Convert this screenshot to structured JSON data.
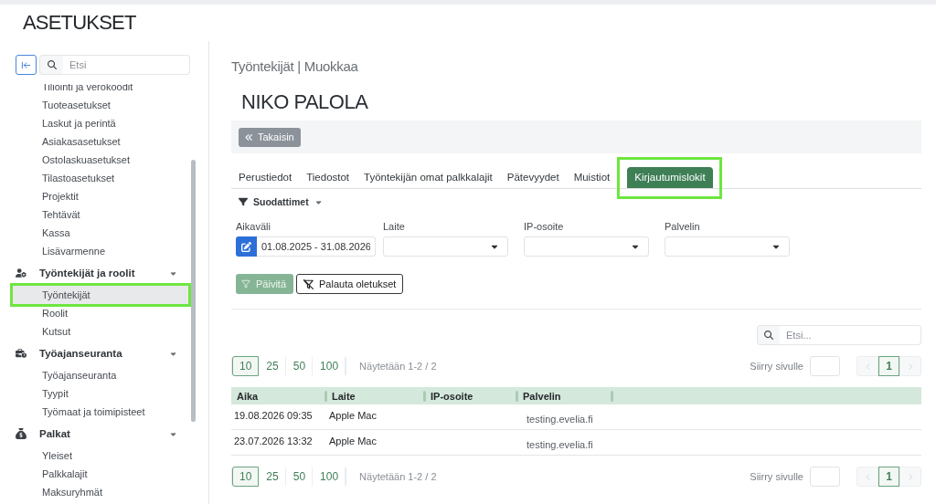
{
  "page_title": "ASETUKSET",
  "sidebar": {
    "search": {
      "placeholder": "Etsi"
    },
    "sections": [
      {
        "items": [
          {
            "label": "Tiliöinti ja verokoodit",
            "selected": false,
            "highlighted": false
          },
          {
            "label": "Tuoteasetukset",
            "selected": false,
            "highlighted": false
          },
          {
            "label": "Laskut ja perintä",
            "selected": false,
            "highlighted": false
          },
          {
            "label": "Asiakasasetukset",
            "selected": false,
            "highlighted": false
          },
          {
            "label": "Ostolaskuasetukset",
            "selected": false,
            "highlighted": false
          },
          {
            "label": "Tilastoasetukset",
            "selected": false,
            "highlighted": false
          },
          {
            "label": "Projektit",
            "selected": false,
            "highlighted": false
          },
          {
            "label": "Tehtävät",
            "selected": false,
            "highlighted": false
          },
          {
            "label": "Kassa",
            "selected": false,
            "highlighted": false
          },
          {
            "label": "Lisävarmenne",
            "selected": false,
            "highlighted": false
          }
        ]
      },
      {
        "title": "Työntekijät ja roolit",
        "expanded": true,
        "items": [
          {
            "label": "Työntekijät",
            "selected": true,
            "highlighted": true
          },
          {
            "label": "Roolit",
            "selected": false,
            "highlighted": false
          },
          {
            "label": "Kutsut",
            "selected": false,
            "highlighted": false
          }
        ]
      },
      {
        "title": "Työajanseuranta",
        "expanded": true,
        "items": [
          {
            "label": "Työajanseuranta",
            "selected": false,
            "highlighted": false
          },
          {
            "label": "Tyypit",
            "selected": false,
            "highlighted": false
          },
          {
            "label": "Työmaat ja toimipisteet",
            "selected": false,
            "highlighted": false
          }
        ]
      },
      {
        "title": "Palkat",
        "expanded": true,
        "items": [
          {
            "label": "Yleiset",
            "selected": false,
            "highlighted": false
          },
          {
            "label": "Palkkalajit",
            "selected": false,
            "highlighted": false
          },
          {
            "label": "Maksuryhmät",
            "selected": false,
            "highlighted": false
          }
        ]
      }
    ]
  },
  "page_heading": "Työntekijät | Muokkaa",
  "employee_name": "NIKO PALOLA",
  "toolbar": {
    "back_button": "Takaisin"
  },
  "tabs": [
    {
      "label": "Perustiedot",
      "selected": false,
      "highlighted": false
    },
    {
      "label": "Tiedostot",
      "selected": false,
      "highlighted": false
    },
    {
      "label": "Työntekijän omat palkkalajit",
      "selected": false,
      "highlighted": false
    },
    {
      "label": "Pätevyydet",
      "selected": false,
      "highlighted": false
    },
    {
      "label": "Muistiot",
      "selected": false,
      "highlighted": false
    },
    {
      "label": "Kirjautumislokit",
      "selected": true,
      "highlighted": true
    }
  ],
  "filters": {
    "toggle": "Suodattimet",
    "expanded": true,
    "fields": [
      {
        "kind": "daterange",
        "label": "Aikaväli",
        "value": "01.08.2025 - 31.08.2026"
      },
      {
        "kind": "select",
        "label": "Laite"
      },
      {
        "kind": "select",
        "label": "IP-osoite"
      },
      {
        "kind": "select",
        "label": "Palvelin"
      }
    ],
    "buttons": [
      {
        "kind": "apply",
        "label": "Päivitä",
        "disabled": true
      },
      {
        "kind": "reset",
        "label": "Palauta oletukset",
        "disabled": false
      }
    ]
  },
  "table_search": {
    "placeholder": "Etsi..."
  },
  "pagination_top": {
    "page_sizes": [
      {
        "label": "10",
        "selected": true
      },
      {
        "label": "25",
        "selected": false
      },
      {
        "label": "50",
        "selected": false
      },
      {
        "label": "100",
        "selected": false
      }
    ],
    "summary": "Näytetään 1-2 / 2",
    "goto_label": "Siirry sivulle",
    "pages": [
      {
        "label": "1",
        "selected": true
      }
    ],
    "previous": {
      "disabled": true
    },
    "next": {
      "disabled": true
    }
  },
  "table": {
    "columns": [
      "Aika",
      "Laite",
      "IP-osoite",
      "Palvelin"
    ],
    "rows": [
      {
        "time": "19.08.2026 09:35",
        "device": "Apple Mac",
        "server": "testing.evelia.fi"
      },
      {
        "time": "23.07.2026 13:32",
        "device": "Apple Mac",
        "server": "testing.evelia.fi"
      }
    ]
  },
  "pagination_bottom": {
    "page_sizes": [
      {
        "label": "10",
        "selected": true
      },
      {
        "label": "25",
        "selected": false
      },
      {
        "label": "50",
        "selected": false
      },
      {
        "label": "100",
        "selected": false
      }
    ],
    "summary": "Näytetään 1-2 / 2",
    "goto_label": "Siirry sivulle",
    "pages": [
      {
        "label": "1",
        "selected": true
      }
    ],
    "previous": {
      "disabled": true
    },
    "next": {
      "disabled": true
    }
  }
}
